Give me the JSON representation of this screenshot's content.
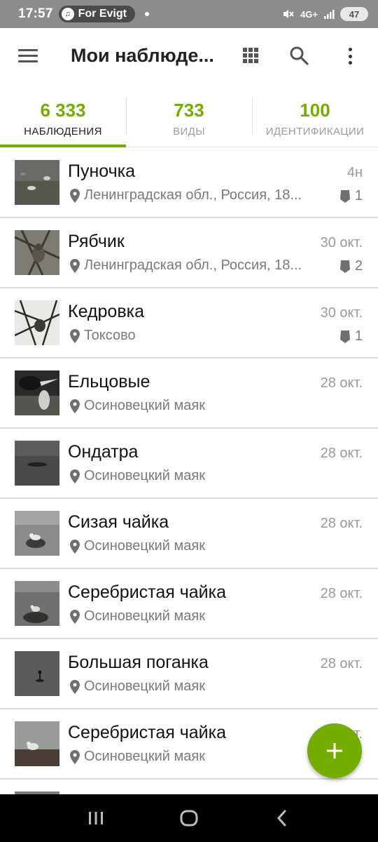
{
  "status_bar": {
    "time": "17:57",
    "notification_app": "For Evigt",
    "network": "4G+",
    "battery": "47"
  },
  "app_bar": {
    "title": "Мои наблюде...",
    "icons": [
      "menu-icon",
      "grid-view-icon",
      "search-icon",
      "more-vert-icon"
    ]
  },
  "tabs": [
    {
      "count": "6 333",
      "label": "НАБЛЮДЕНИЯ",
      "active": true
    },
    {
      "count": "733",
      "label": "ВИДЫ",
      "active": false
    },
    {
      "count": "100",
      "label": "ИДЕНТИФИКАЦИИ",
      "active": false
    }
  ],
  "observations": [
    {
      "species": "Пуночка",
      "date": "4н",
      "location": "Ленинградская обл., Россия, 18...",
      "ids": "1"
    },
    {
      "species": "Рябчик",
      "date": "30 окт.",
      "location": "Ленинградская обл., Россия, 18...",
      "ids": "2"
    },
    {
      "species": "Кедровка",
      "date": "30 окт.",
      "location": "Токсово",
      "ids": "1"
    },
    {
      "species": "Ельцовые",
      "date": "28 окт.",
      "location": "Осиновецкий маяк",
      "ids": ""
    },
    {
      "species": "Ондатра",
      "date": "28 окт.",
      "location": "Осиновецкий маяк",
      "ids": ""
    },
    {
      "species": "Сизая чайка",
      "date": "28 окт.",
      "location": "Осиновецкий маяк",
      "ids": ""
    },
    {
      "species": "Серебристая чайка",
      "date": "28 окт.",
      "location": "Осиновецкий маяк",
      "ids": ""
    },
    {
      "species": "Большая поганка",
      "date": "28 окт.",
      "location": "Осиновецкий маяк",
      "ids": ""
    },
    {
      "species": "Серебристая чайка",
      "date": "28 окт.",
      "location": "Осиновецкий маяк",
      "ids": ""
    }
  ],
  "fab": {
    "icon": "add-icon"
  },
  "nav_bar": {
    "icons": [
      "recents-icon",
      "home-icon",
      "back-icon"
    ]
  },
  "colors": {
    "accent": "#74ac00",
    "status_bar": "#8c8c8c",
    "nav_bar": "#000000"
  }
}
